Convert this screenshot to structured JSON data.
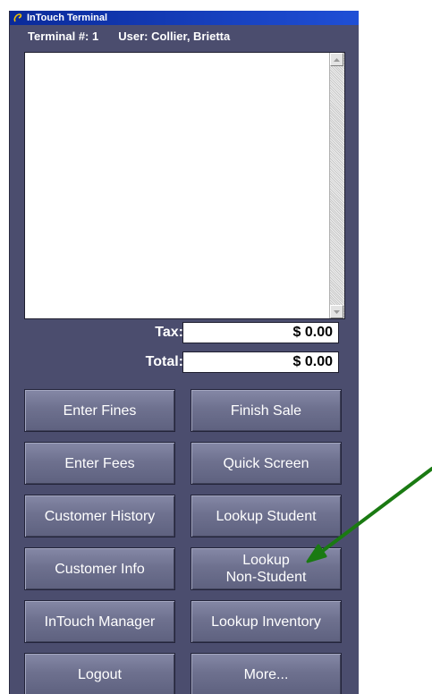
{
  "window": {
    "title": "InTouch Terminal",
    "terminal_label": "Terminal #: 1",
    "user_label": "User: Collier, Brietta"
  },
  "totals": {
    "tax_label": "Tax:",
    "tax_value": "$ 0.00",
    "total_label": "Total:",
    "total_value": "$ 0.00"
  },
  "buttons": {
    "enter_fines": "Enter Fines",
    "finish_sale": "Finish Sale",
    "enter_fees": "Enter Fees",
    "quick_screen": "Quick Screen",
    "customer_history": "Customer History",
    "lookup_student": "Lookup Student",
    "customer_info": "Customer Info",
    "lookup_non_student": "Lookup\nNon-Student",
    "intouch_manager": "InTouch Manager",
    "lookup_inventory": "Lookup Inventory",
    "logout": "Logout",
    "more": "More..."
  },
  "colors": {
    "panel_bg": "#4b4d6e",
    "button_bg": "#6e718f",
    "titlebar": "#0a2a9a",
    "annotation_arrow": "#1a7a12"
  },
  "icons": {
    "app": "intouch-logo-icon",
    "scroll_up": "triangle-up-icon",
    "scroll_down": "triangle-down-icon",
    "annotation": "green-arrow"
  }
}
